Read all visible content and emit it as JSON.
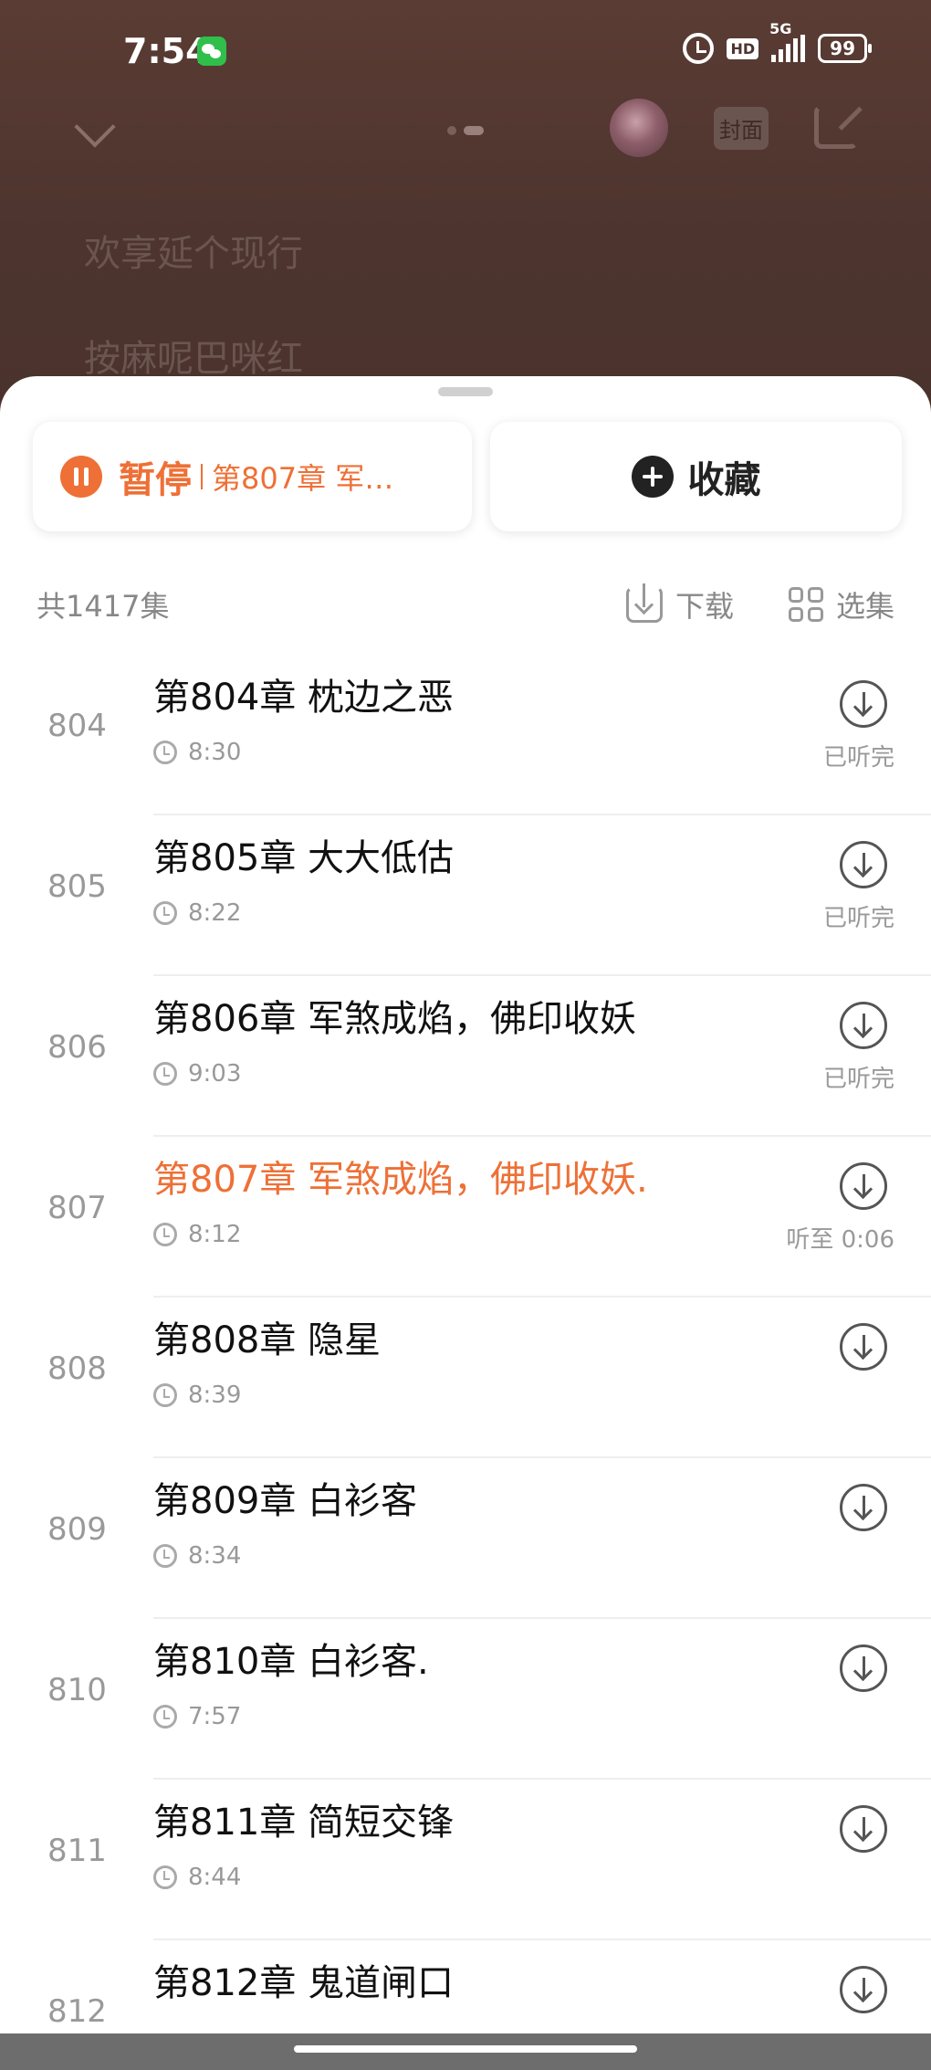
{
  "status_bar": {
    "time": "7:54",
    "network": "5G",
    "hd": "HD",
    "battery": "99"
  },
  "player_bg": {
    "cover_label": "封面",
    "lyric_1": "欢享延个现行",
    "lyric_2": "按麻呢巴咪红"
  },
  "actions": {
    "pause_label": "暂停",
    "current_chapter": "第807章 军煞成焰，佛印收妖.",
    "favorite_label": "收藏"
  },
  "list_header": {
    "count": "共1417集",
    "download_label": "下载",
    "select_label": "选集"
  },
  "episodes": [
    {
      "num": "804",
      "title": "第804章 枕边之恶",
      "duration": "8:30",
      "progress": "已听完"
    },
    {
      "num": "805",
      "title": "第805章 大大低估",
      "duration": "8:22",
      "progress": "已听完"
    },
    {
      "num": "806",
      "title": "第806章 军煞成焰，佛印收妖",
      "duration": "9:03",
      "progress": "已听完"
    },
    {
      "num": "807",
      "title": "第807章 军煞成焰，佛印收妖.",
      "duration": "8:12",
      "progress": "听至 0:06"
    },
    {
      "num": "808",
      "title": "第808章 隐星",
      "duration": "8:39",
      "progress": ""
    },
    {
      "num": "809",
      "title": "第809章 白衫客",
      "duration": "8:34",
      "progress": ""
    },
    {
      "num": "810",
      "title": "第810章 白衫客.",
      "duration": "7:57",
      "progress": ""
    },
    {
      "num": "811",
      "title": "第811章 简短交锋",
      "duration": "8:44",
      "progress": ""
    },
    {
      "num": "812",
      "title": "第812章 鬼道闸口",
      "duration": "",
      "progress": ""
    }
  ],
  "colors": {
    "accent": "#ee7036",
    "bg_dim": "#4d342e"
  }
}
